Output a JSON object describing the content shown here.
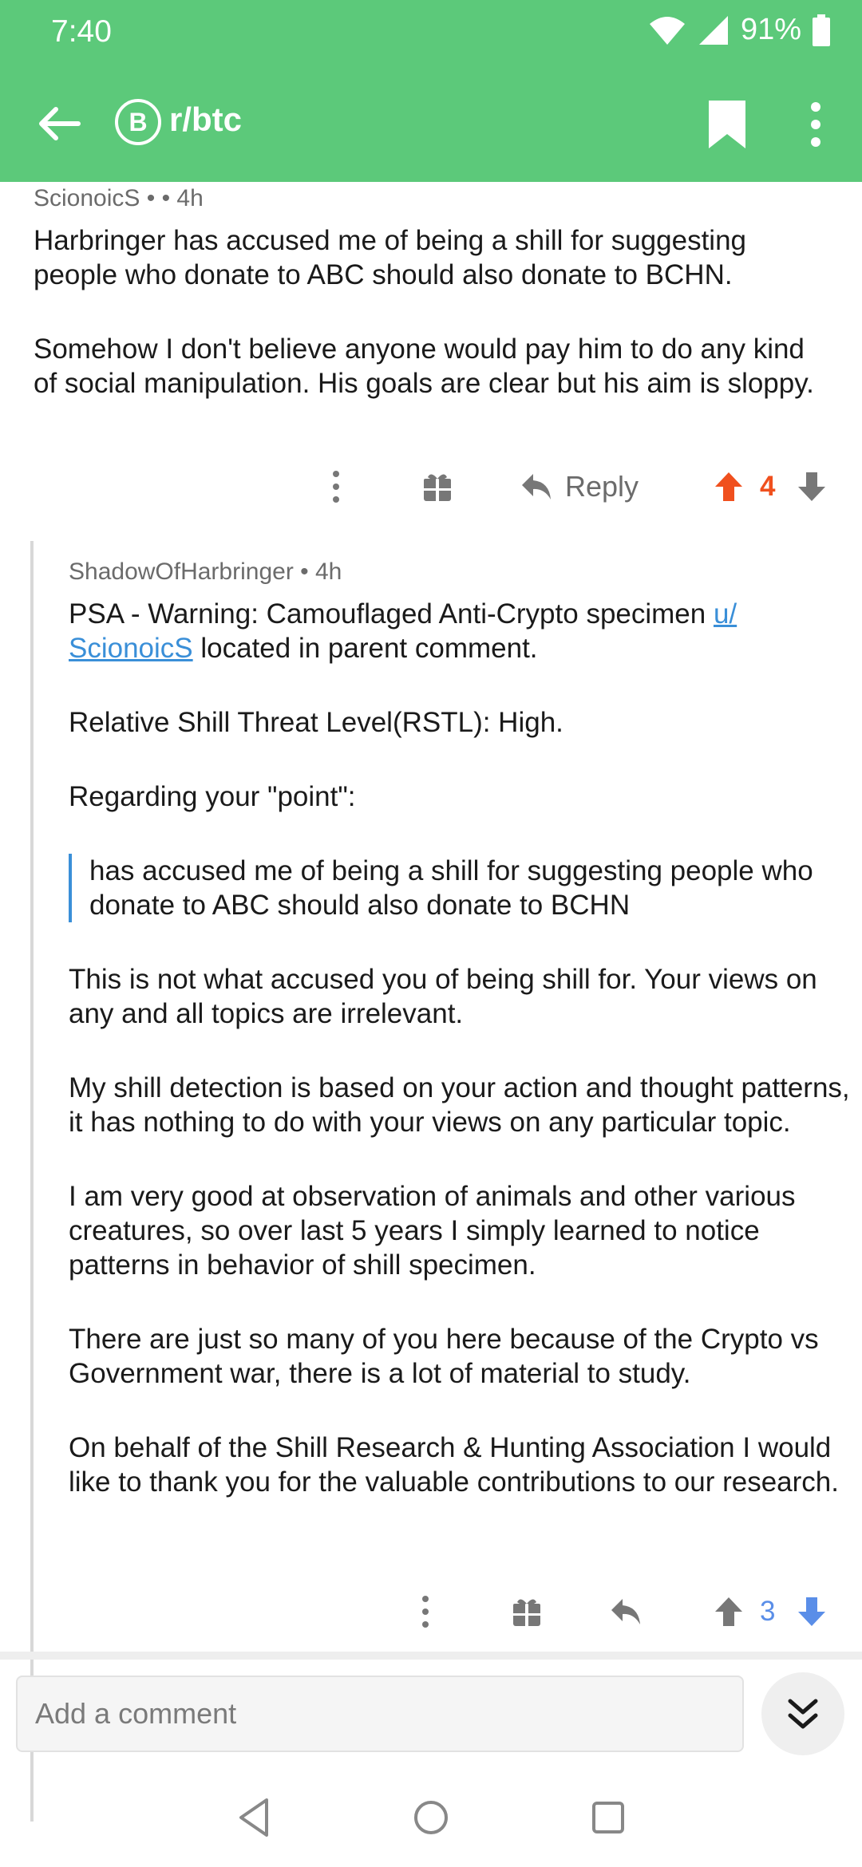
{
  "status": {
    "time": "7:40",
    "battery": "91%"
  },
  "appbar": {
    "subreddit": "r/btc",
    "sub_icon_glyph": "B"
  },
  "comments": [
    {
      "author": "ScionoicS •",
      "time": "• 4h",
      "paragraphs": [
        "Harbringer has accused me of being a shill for suggesting people who donate to ABC should also donate to BCHN.",
        "Somehow I don't believe anyone would pay him to do any kind of social manipulation. His goals are clear but his aim is sloppy."
      ],
      "reply_label": "Reply",
      "score": "4",
      "vote_state": "up"
    },
    {
      "author": "ShadowOfHarbringer • 4h",
      "intro_before_link": "PSA - Warning: Camouflaged Anti-Crypto specimen ",
      "link_text": "u/ ScionoicS",
      "intro_after_link": " located in parent comment.",
      "threat": "Relative Shill Threat Level(RSTL): High.",
      "regarding": "Regarding your \"point\":",
      "quote": "has accused me of being a shill for suggesting people who donate to ABC should also donate to BCHN",
      "paragraphs": [
        "This is not what accused you of being shill for. Your views on any and all topics are irrelevant.",
        "My shill detection is based on your action and thought patterns, it has nothing to do with your views on any particular topic.",
        "I am very good at observation of animals and other various creatures, so over last 5 years I simply learned to notice patterns in behavior of shill specimen.",
        "There are just so many of you here because of the Crypto vs Government war, there is a lot of material to study.",
        "On behalf of the Shill Research & Hunting Association I would like to thank you for the valuable contributions to our research."
      ],
      "score": "3",
      "vote_state": "down"
    }
  ],
  "compose": {
    "placeholder": "Add a comment"
  },
  "colors": {
    "appbar": "#5cc97a",
    "upvote": "#f0501e",
    "downvote": "#5a8ee8",
    "link": "#3a8fd8"
  }
}
